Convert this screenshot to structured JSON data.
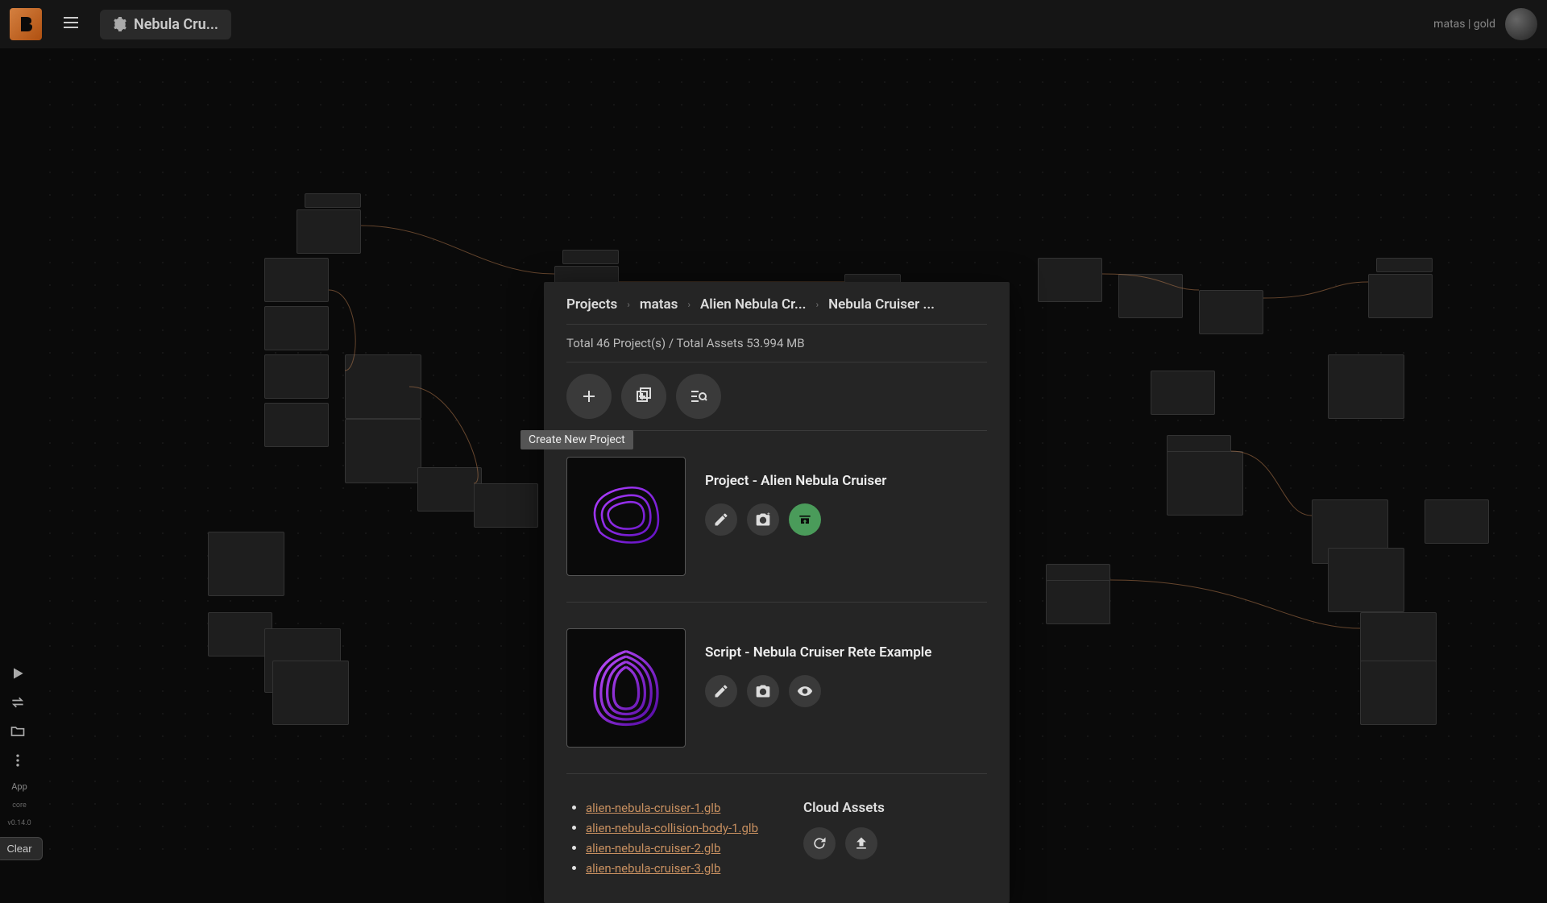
{
  "header": {
    "title": "Nebula Cru...",
    "user": "matas | gold"
  },
  "breadcrumb": {
    "b0": "Projects",
    "b1": "matas",
    "b2": "Alien Nebula Cr...",
    "b3": "Nebula Cruiser ..."
  },
  "stats": "Total 46 Project(s) / Total Assets 53.994 MB",
  "tooltip": "Create New Project",
  "project": {
    "title": "Project - Alien Nebula Cruiser"
  },
  "script": {
    "title": "Script - Nebula Cruiser Rete Example"
  },
  "assets": {
    "header": "Cloud Assets",
    "a0": "alien-nebula-cruiser-1.glb",
    "a1": "alien-nebula-collision-body-1.glb",
    "a2": "alien-nebula-cruiser-2.glb",
    "a3": "alien-nebula-cruiser-3.glb"
  },
  "rail": {
    "app": "App",
    "core": "core",
    "version": "v0.14.0",
    "clear": "Clear"
  }
}
